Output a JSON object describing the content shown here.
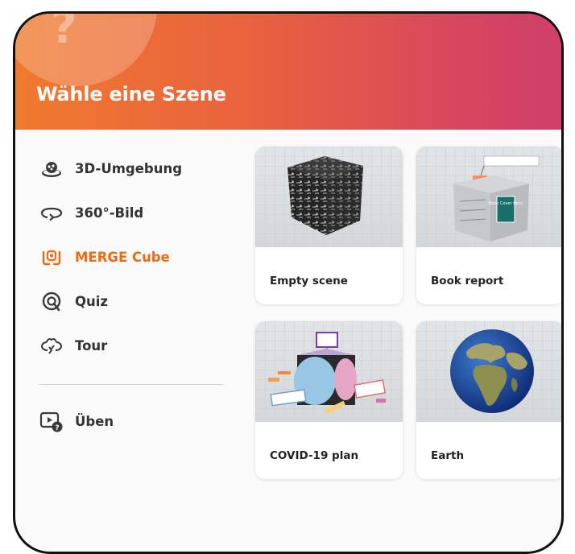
{
  "header": {
    "title": "Wähle eine Szene",
    "help_glyph": "?"
  },
  "sidebar": {
    "items": [
      {
        "label": "3D-Umgebung",
        "icon": "3d-environment-icon",
        "active": false
      },
      {
        "label": "360°-Bild",
        "icon": "360-image-icon",
        "active": false
      },
      {
        "label": "MERGE Cube",
        "icon": "merge-cube-icon",
        "active": true
      },
      {
        "label": "Quiz",
        "icon": "quiz-icon",
        "active": false
      },
      {
        "label": "Tour",
        "icon": "tour-icon",
        "active": false
      }
    ],
    "practice": {
      "label": "Üben",
      "icon": "practice-video-icon"
    }
  },
  "scenes": [
    {
      "label": "Empty scene",
      "thumb": "patterned-cube"
    },
    {
      "label": "Book report",
      "thumb": "book-report-cube"
    },
    {
      "label": "COVID-19 plan",
      "thumb": "covid-plan-cube"
    },
    {
      "label": "Earth",
      "thumb": "earth-globe"
    }
  ],
  "thumb_text": {
    "book_cover": "Book Cover Here"
  },
  "colors": {
    "accent": "#ee6a12",
    "header_start": "#ef7a2e",
    "header_end": "#cf3f6a",
    "text": "#333333"
  }
}
